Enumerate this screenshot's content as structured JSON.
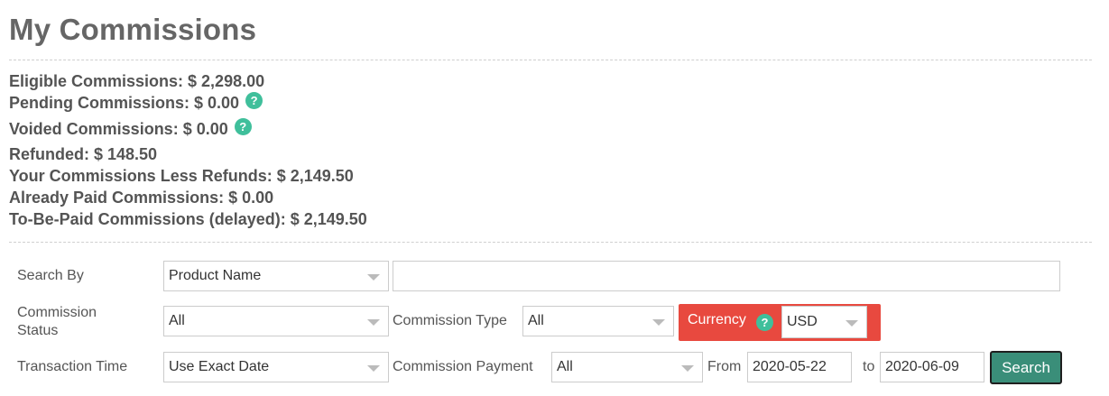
{
  "page": {
    "title": "My Commissions"
  },
  "summary": {
    "eligible": "Eligible Commissions: $ 2,298.00",
    "pending": "Pending Commissions: $ 0.00",
    "voided": "Voided Commissions: $ 0.00",
    "refunded": "Refunded: $ 148.50",
    "less_refunds": "Your Commissions Less Refunds: $ 2,149.50",
    "already_paid": "Already Paid Commissions: $ 0.00",
    "to_be_paid": "To-Be-Paid Commissions (delayed): $ 2,149.50",
    "help_glyph": "?"
  },
  "filters": {
    "search_by_label": "Search By",
    "search_by_value": "Product Name",
    "search_text_value": "",
    "commission_status_label": "Commission Status",
    "commission_status_value": "All",
    "commission_type_label": "Commission Type",
    "commission_type_value": "All",
    "currency_label": "Currency",
    "currency_value": "USD",
    "transaction_time_label": "Transaction Time",
    "transaction_time_value": "Use Exact Date",
    "commission_payment_label": "Commission Payment",
    "commission_payment_value": "All",
    "from_label": "From",
    "from_value": "2020-05-22",
    "to_label": "to",
    "to_value": "2020-06-09",
    "search_button": "Search"
  },
  "colors": {
    "currency_bg": "#e8493f",
    "help_icon": "#3fbf9b",
    "search_button": "#3a8e79"
  },
  "icons": [
    "help-icon",
    "chevron-down-icon"
  ]
}
